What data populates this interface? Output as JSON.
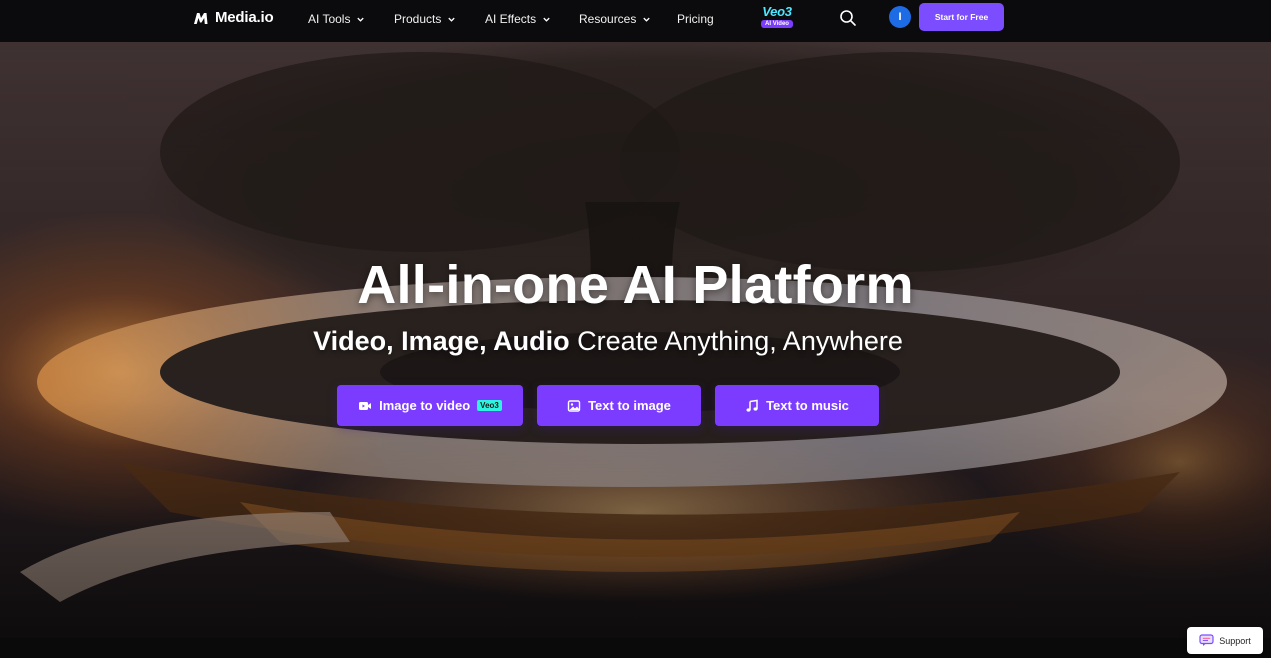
{
  "nav": {
    "logo_text": "Media.io",
    "items": [
      {
        "label": "AI Tools",
        "has_dropdown": true
      },
      {
        "label": "Products",
        "has_dropdown": true
      },
      {
        "label": "AI Effects",
        "has_dropdown": true
      },
      {
        "label": "Resources",
        "has_dropdown": true
      },
      {
        "label": "Pricing",
        "has_dropdown": false
      }
    ],
    "veo": {
      "title": "Veo3",
      "badge": "AI Video"
    },
    "avatar_initial": "I",
    "start_button": "Start for Free"
  },
  "hero": {
    "title": "All-in-one AI Platform",
    "subtitle_bold": "Video, Image, Audio",
    "subtitle_rest": " Create Anything, Anywhere",
    "buttons": [
      {
        "label": "Image to video",
        "icon": "video-camera-icon",
        "badge": "Veo3"
      },
      {
        "label": "Text to image",
        "icon": "image-icon"
      },
      {
        "label": "Text to music",
        "icon": "music-note-icon"
      }
    ]
  },
  "support": {
    "label": "Support",
    "icon": "chat-bubble-icon"
  },
  "colors": {
    "accent": "#7b3cff",
    "nav_bg": "#0b0b0d",
    "avatar": "#1e6be6",
    "veo": "#4ee7ff",
    "badge": "#2ff3e0"
  }
}
